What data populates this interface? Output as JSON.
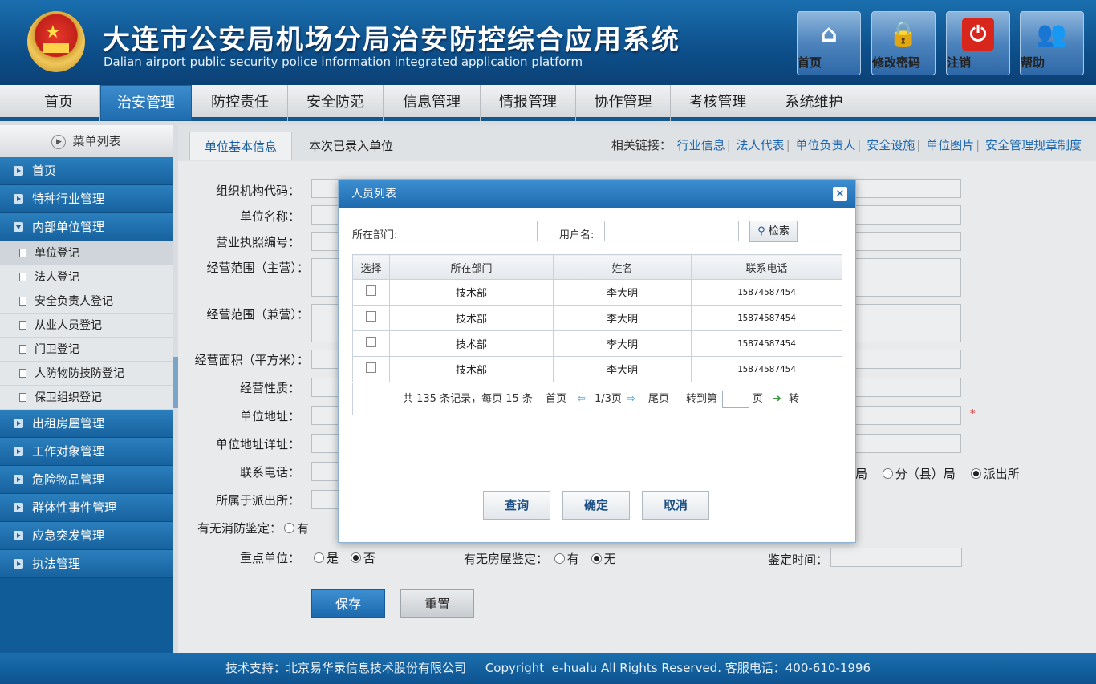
{
  "header": {
    "title_zh": "大连市公安局机场分局治安防控综合应用系统",
    "title_en": "Dalian airport public security police information integrated application platform",
    "buttons": [
      {
        "label": "首页",
        "icon": "home-icon"
      },
      {
        "label": "修改密码",
        "icon": "lock-icon"
      },
      {
        "label": "注销",
        "icon": "power-icon"
      },
      {
        "label": "帮助",
        "icon": "help-users-icon"
      }
    ]
  },
  "nav": [
    "首页",
    "治安管理",
    "防控责任",
    "安全防范",
    "信息管理",
    "情报管理",
    "协作管理",
    "考核管理",
    "系统维护"
  ],
  "nav_active": "治安管理",
  "sidebar": {
    "header": "菜单列表",
    "items": [
      "首页",
      "特种行业管理",
      "内部单位管理"
    ],
    "subitems": [
      "单位登记",
      "法人登记",
      "安全负责人登记",
      "从业人员登记",
      "门卫登记",
      "人防物防技防登记",
      "保卫组织登记"
    ],
    "items_after": [
      "出租房屋管理",
      "工作对象管理",
      "危险物品管理",
      "群体性事件管理",
      "应急突发管理",
      "执法管理"
    ]
  },
  "tabs": [
    "单位基本信息",
    "本次已录入单位"
  ],
  "related_links": {
    "label": "相关链接：",
    "links": [
      "行业信息",
      "法人代表",
      "单位负责人",
      "安全设施",
      "单位图片",
      "安全管理规章制度"
    ]
  },
  "form": {
    "fields": [
      "组织机构代码：",
      "单位名称：",
      "营业执照编号：",
      "经营范围（主营）：",
      "经营范围（兼营）：",
      "经营面积（平方米）：",
      "经营性质：",
      "单位地址：",
      "单位地址详址：",
      "联系电话：",
      "所属于派出所："
    ],
    "fire_label": "有无消防鉴定：",
    "fire_opt": "有",
    "key_unit_label": "重点单位：",
    "key_unit_opts": [
      "是",
      "否"
    ],
    "house_label": "有无房屋鉴定：",
    "house_opts": [
      "有",
      "无"
    ],
    "appraise_time_label": "鉴定时间：",
    "level_opts": [
      "局",
      "分（县）局",
      "派出所"
    ],
    "required_mark": "*",
    "save": "保存",
    "reset": "重置"
  },
  "modal": {
    "title": "人员列表",
    "close": "×",
    "dept_label": "所在部门:",
    "user_label": "用户名:",
    "search": "检索",
    "columns": [
      "选择",
      "所在部门",
      "姓名",
      "联系电话"
    ],
    "rows": [
      {
        "dept": "技术部",
        "name": "李大明",
        "phone": "15874587454"
      },
      {
        "dept": "技术部",
        "name": "李大明",
        "phone": "15874587454"
      },
      {
        "dept": "技术部",
        "name": "李大明",
        "phone": "15874587454"
      },
      {
        "dept": "技术部",
        "name": "李大明",
        "phone": "15874587454"
      }
    ],
    "pager": {
      "summary": "共 135 条记录，每页 15 条",
      "first": "首页",
      "page": "1/3页",
      "last": "尾页",
      "goto": "转到第",
      "page_unit": "页",
      "go": "转"
    },
    "buttons": [
      "查询",
      "确定",
      "取消"
    ]
  },
  "footer": "技术支持：北京易华录信息技术股份有限公司     Copyright  e-hualu All Rights Reserved. 客服电话：400-610-1996"
}
